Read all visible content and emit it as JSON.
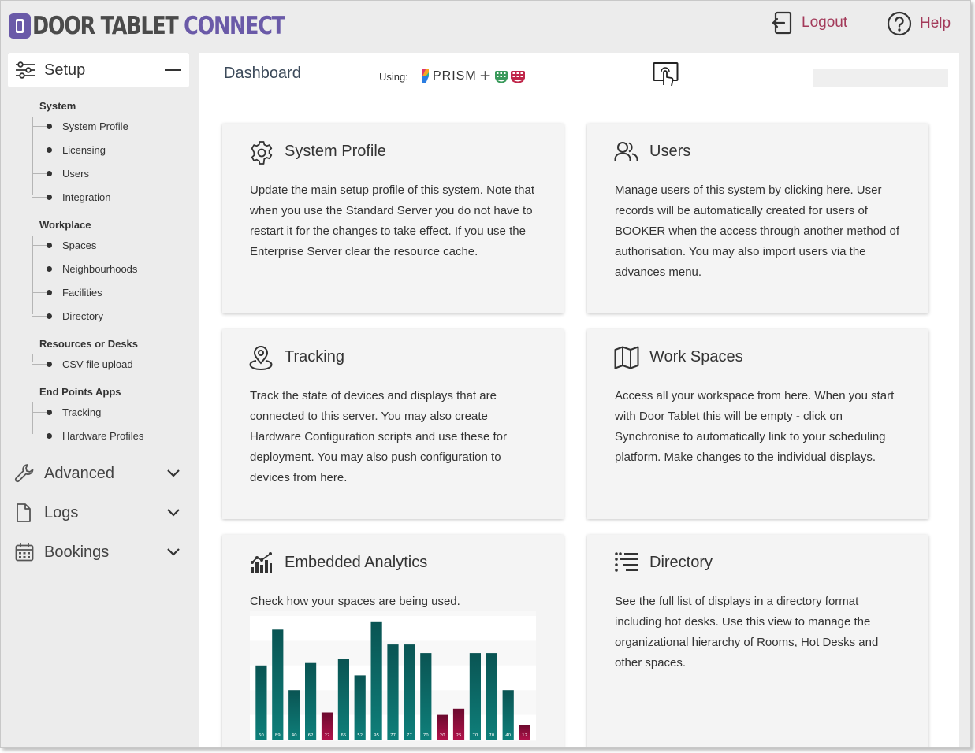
{
  "app": {
    "logo_part1": "DOOR TABLET ",
    "logo_part2": "CONNECT",
    "logout_label": "Logout",
    "help_label": "Help",
    "accent": "#a33a5a",
    "brand": "#6a5aa8"
  },
  "sidebar": {
    "setup_label": "Setup",
    "groups": [
      {
        "label": "System",
        "items": [
          "System Profile",
          "Licensing",
          "Users",
          "Integration"
        ]
      },
      {
        "label": "Workplace",
        "items": [
          "Spaces",
          "Neighbourhoods",
          "Facilities",
          "Directory"
        ]
      },
      {
        "label": "Resources or Desks",
        "items": [
          "CSV file upload"
        ]
      },
      {
        "label": "End Points Apps",
        "items": [
          "Tracking",
          "Hardware Profiles"
        ]
      }
    ],
    "menus": [
      {
        "label": "Advanced",
        "icon": "wrench-icon"
      },
      {
        "label": "Logs",
        "icon": "file-icon"
      },
      {
        "label": "Bookings",
        "icon": "calendar-icon"
      }
    ]
  },
  "header": {
    "title": "Dashboard",
    "using_label": "Using:",
    "platform_label": "PRISM"
  },
  "cards": [
    {
      "title": "System Profile",
      "icon": "gear-icon",
      "text": "Update the main setup profile of this system. Note that when you use the Standard Server you do not have to restart it for the changes to take effect. If you use the Enterprise Server clear the resource cache."
    },
    {
      "title": "Users",
      "icon": "users-icon",
      "text": "Manage users of this system by clicking here. User records will be automatically created for users of BOOKER when the access through another method of authorisation. You may also import users via the advances menu."
    },
    {
      "title": "Tracking",
      "icon": "location-pin-icon",
      "text": "Track the state of devices and displays that are connected to this server. You may also create Hardware Configuration scripts and use these for deployment. You may also push configuration to devices from here."
    },
    {
      "title": "Work Spaces",
      "icon": "map-icon",
      "text": "Access all your workspace from here. When you start with Door Tablet this will be empty - click on Synchronise to automatically link to your scheduling platform. Make changes to the individual displays."
    },
    {
      "title": "Embedded Analytics",
      "icon": "analytics-icon",
      "text": "Check how your spaces are being used."
    },
    {
      "title": "Directory",
      "icon": "list-icon",
      "text": "See the full list of displays in a directory format including hot desks. Use this view to manage the organizational hierarchy of Rooms, Hot Desks and other spaces."
    }
  ],
  "chart_data": {
    "type": "bar",
    "values": [
      60,
      89,
      40,
      62,
      22,
      65,
      52,
      95,
      77,
      77,
      70,
      20,
      25,
      70,
      70,
      40,
      12
    ],
    "ylim": [
      0,
      100
    ],
    "colors": {
      "high": "#0e7f7a",
      "low": "#b0124a"
    }
  }
}
